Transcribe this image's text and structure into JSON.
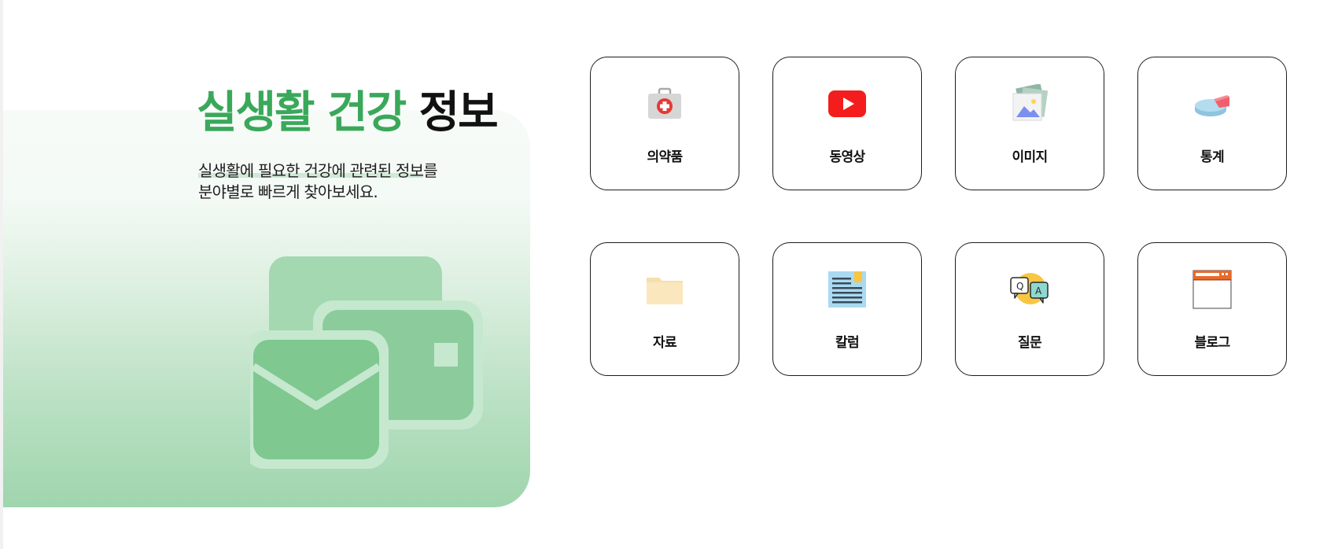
{
  "hero": {
    "title_green": "실생활 건강",
    "title_black": "정보",
    "desc_line1_highlight": "실생활에 필요한 건강에 관련된 정보",
    "desc_line1_rest": "를",
    "desc_line2": "분야별로 빠르게 찾아보세요."
  },
  "categories": [
    {
      "label": "의약품",
      "icon": "medical-kit-icon"
    },
    {
      "label": "동영상",
      "icon": "youtube-play-icon"
    },
    {
      "label": "이미지",
      "icon": "image-stack-icon"
    },
    {
      "label": "통계",
      "icon": "pie-chart-icon"
    },
    {
      "label": "자료",
      "icon": "folder-icon"
    },
    {
      "label": "칼럼",
      "icon": "document-icon"
    },
    {
      "label": "질문",
      "icon": "qa-chat-icon"
    },
    {
      "label": "블로그",
      "icon": "browser-window-icon"
    }
  ],
  "colors": {
    "accent_green": "#3aa85a",
    "illustration_green": "#7fc890",
    "card_border": "#1c1c1c"
  }
}
